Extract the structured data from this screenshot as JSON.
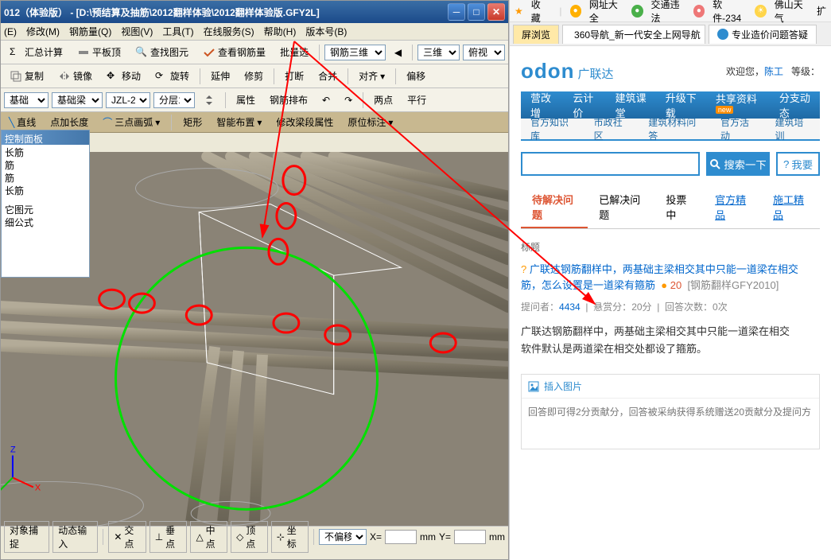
{
  "cad": {
    "title": "012（体验版） - [D:\\预结算及抽筋\\2012翻样体验\\2012翻样体验版.GFY2L]",
    "menu": [
      "(E)",
      "修改(M)",
      "钢筋量(Q)",
      "视图(V)",
      "工具(T)",
      "在线服务(S)",
      "帮助(H)",
      "版本号(B)"
    ],
    "tb1": {
      "calc": "汇总计算",
      "flat": "平板顶",
      "findmap": "查找图元",
      "rebar": "查看钢筋量",
      "batch": "批量选",
      "rebar3d": "钢筋三维",
      "view3d": "三维",
      "persp": "俯视"
    },
    "tb2": {
      "copy": "复制",
      "mirror": "镜像",
      "move": "移动",
      "rotate": "旋转",
      "extend": "延伸",
      "trim": "修剪",
      "split": "打断",
      "merge": "合并",
      "align": "对齐",
      "offset": "偏移"
    },
    "tb3": {
      "sel1": "基础",
      "sel2": "基础梁",
      "sel3": "JZL-2",
      "sel4": "分层1",
      "attr": "属性",
      "steel": "钢筋排布",
      "two": "两点",
      "parallel": "平行"
    },
    "tb4": {
      "line": "直线",
      "addlen": "点加长度",
      "arc": "三点画弧",
      "rect": "矩形",
      "smart": "智能布置",
      "editbeam": "修改梁段属性",
      "origin": "原位标注"
    },
    "ctrl_panel": {
      "header": "控制面板",
      "items": [
        "长筋",
        "筋",
        "筋",
        "长筋",
        "",
        "它图元",
        "细公式"
      ]
    },
    "status": {
      "snap": "对象捕捉",
      "dyninput": "动态输入",
      "intersect": "交点",
      "perpend": "垂点",
      "mid": "中点",
      "peak": "顶点",
      "coord": "坐标",
      "nooffset": "不偏移",
      "x": "X=",
      "mm1": "mm",
      "y": "Y=",
      "mm2": "mm"
    }
  },
  "browser": {
    "favbar": {
      "fav": "收藏",
      "siteall": "网址大全",
      "traffic": "交通违法",
      "soft": "软件-234",
      "weather": "佛山天气",
      "more": "扩"
    },
    "tabs": {
      "t0": "屏浏览",
      "t1": "360导航_新一代安全上网导航",
      "t2": "专业造价问题答疑"
    },
    "logo": "odon",
    "logo_cn": "广联达",
    "welcome": "欢迎您，",
    "user": "陈工",
    "level": "等级：",
    "nav_blue": [
      "营改增",
      "云计价",
      "建筑课堂",
      "升级下载",
      "共享资料",
      "分支动态"
    ],
    "nav_sub": [
      "官方知识库",
      "市政社区",
      "建筑材料问答",
      "官方活动",
      "建筑培训"
    ],
    "search_btn": "搜索一下",
    "ask": "我要",
    "ctabs": {
      "pending": "待解决问题",
      "solved": "已解决问题",
      "voting": "投票中",
      "official": "官方精品",
      "site": "施工精品"
    },
    "post": {
      "title_label": "标题",
      "q_title_1": "广联达钢筋翻样中，两基础主梁相交其中只能一道梁在相交",
      "q_title_2": "筋，怎么设置是一道梁有箍筋",
      "score": "20",
      "tag": "[钢筋翻样GFY2010]",
      "meta_asker_lbl": "提问者：",
      "meta_asker": "4434",
      "meta_bounty_lbl": "悬赏分：",
      "meta_bounty": "20分",
      "meta_answers_lbl": "回答次数：",
      "meta_answers": "0次",
      "desc_1": "广联达钢筋翻样中，两基础主梁相交其中只能一道梁在相交",
      "desc_2": "软件默认是两道梁在相交处都设了箍筋。",
      "insert_pic": "插入图片",
      "answer_ph": "回答即可得2分贡献分，回答被采纳获得系统赠送20贡献分及提问方"
    }
  }
}
